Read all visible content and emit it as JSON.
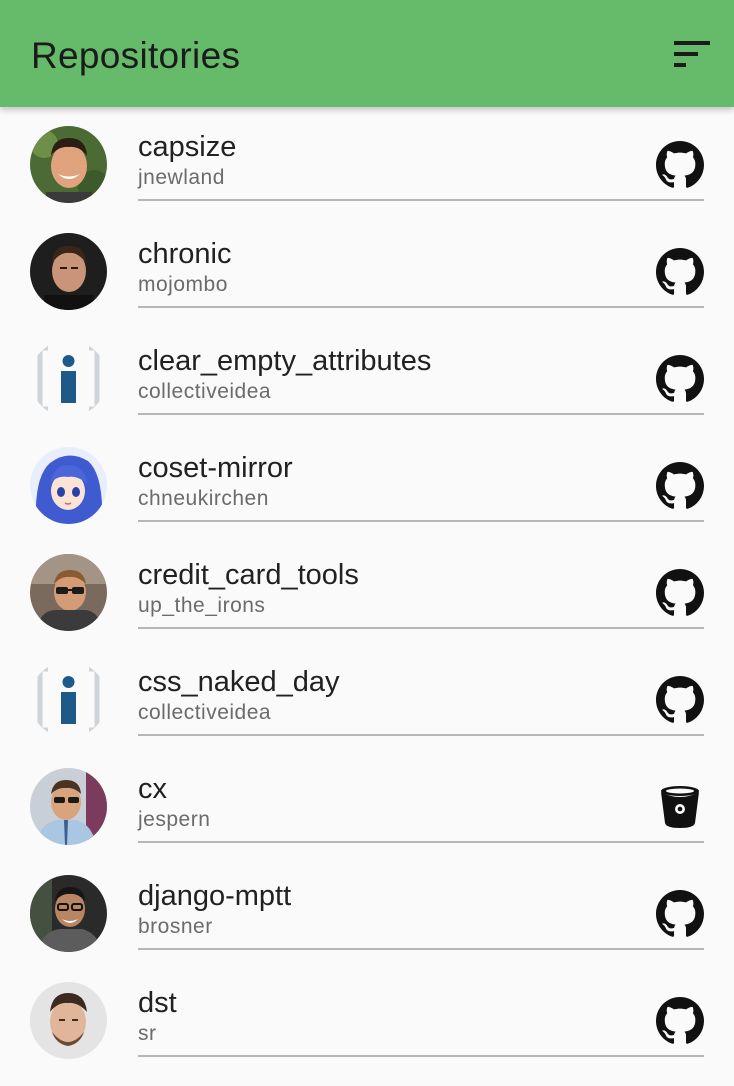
{
  "appbar": {
    "title": "Repositories",
    "sort_icon": "sort-icon",
    "color": "#66bb6a"
  },
  "repositories": [
    {
      "name": "capsize",
      "owner": "jnewland",
      "source_icon": "github-icon",
      "avatar": "photo"
    },
    {
      "name": "chronic",
      "owner": "mojombo",
      "source_icon": "github-icon",
      "avatar": "photo"
    },
    {
      "name": "clear_empty_attributes",
      "owner": "collectiveidea",
      "source_icon": "github-icon",
      "avatar": "logo"
    },
    {
      "name": "coset-mirror",
      "owner": "chneukirchen",
      "source_icon": "github-icon",
      "avatar": "illustration"
    },
    {
      "name": "credit_card_tools",
      "owner": "up_the_irons",
      "source_icon": "github-icon",
      "avatar": "photo"
    },
    {
      "name": "css_naked_day",
      "owner": "collectiveidea",
      "source_icon": "github-icon",
      "avatar": "logo"
    },
    {
      "name": "cx",
      "owner": "jespern",
      "source_icon": "bitbucket-icon",
      "avatar": "photo"
    },
    {
      "name": "django-mptt",
      "owner": "brosner",
      "source_icon": "github-icon",
      "avatar": "photo"
    },
    {
      "name": "dst",
      "owner": "sr",
      "source_icon": "github-icon",
      "avatar": "photo"
    }
  ]
}
